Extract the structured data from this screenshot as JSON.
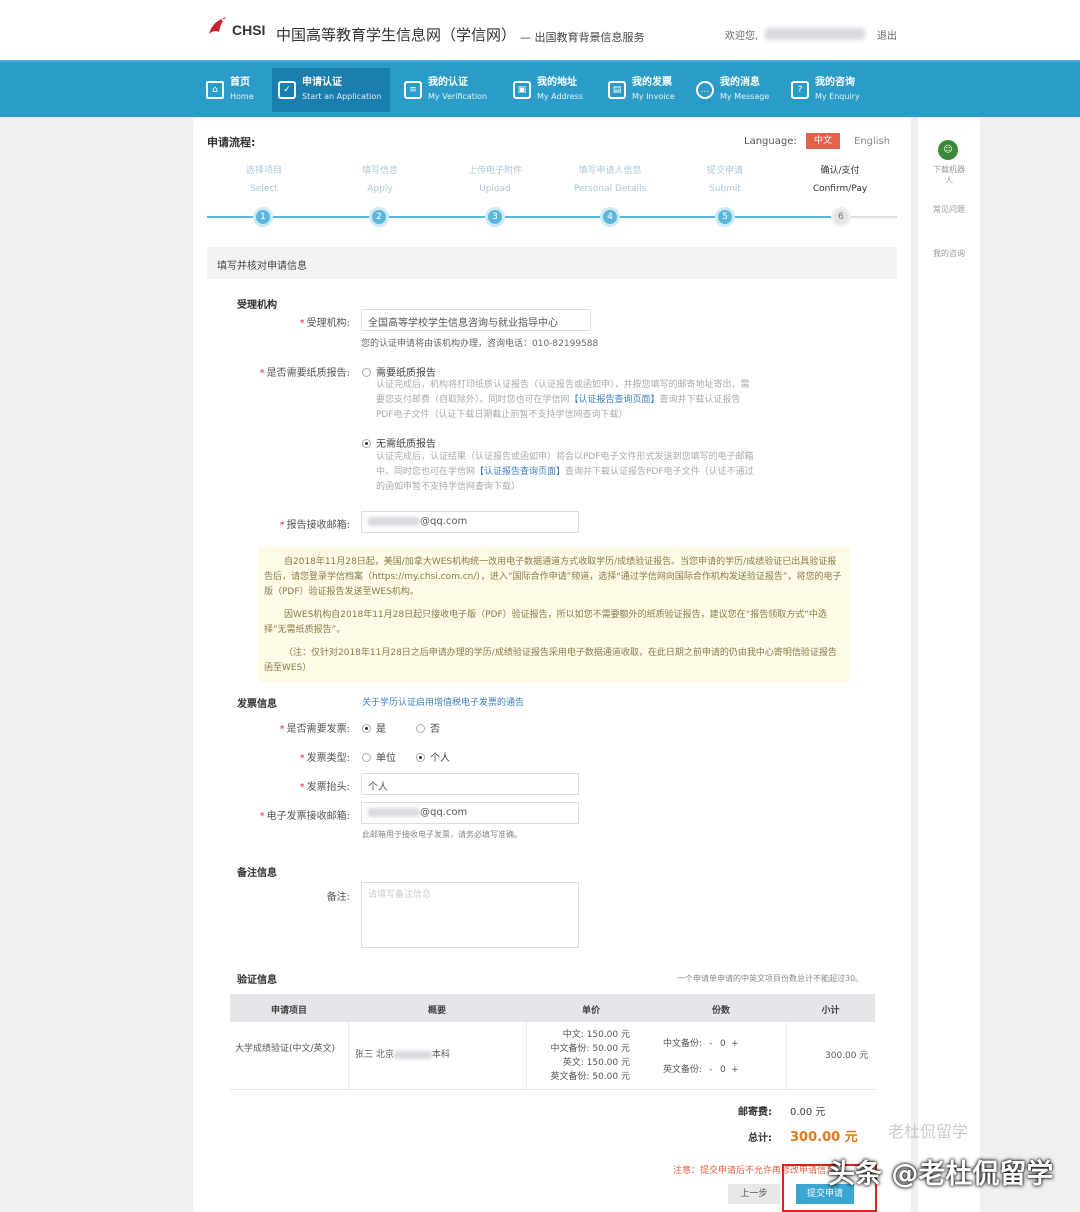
{
  "header": {
    "logo_text": "CHSI",
    "site_title": "中国高等教育学生信息网（学信网）",
    "site_subtitle": "— 出国教育背景信息服务",
    "welcome": "欢迎您,",
    "logout": "退出"
  },
  "nav": [
    {
      "cn": "首页",
      "en": "Home",
      "icon": "home-icon"
    },
    {
      "cn": "申请认证",
      "en": "Start an Application",
      "icon": "check-icon"
    },
    {
      "cn": "我的认证",
      "en": "My Verification",
      "icon": "certificate-icon"
    },
    {
      "cn": "我的地址",
      "en": "My Address",
      "icon": "address-icon"
    },
    {
      "cn": "我的发票",
      "en": "My Invoice",
      "icon": "invoice-icon"
    },
    {
      "cn": "我的消息",
      "en": "My Message",
      "icon": "message-icon"
    },
    {
      "cn": "我的咨询",
      "en": "My Enquiry",
      "icon": "enquiry-icon"
    }
  ],
  "process": {
    "title": "申请流程:",
    "language_label": "Language:",
    "lang_cn": "中文",
    "lang_en": "English",
    "steps": [
      {
        "cn": "选择项目",
        "en": "Select",
        "num": "1"
      },
      {
        "cn": "填写信息",
        "en": "Apply",
        "num": "2"
      },
      {
        "cn": "上传电子附件",
        "en": "Upload",
        "num": "3"
      },
      {
        "cn": "填写申请人信息",
        "en": "Personal Details",
        "num": "4"
      },
      {
        "cn": "提交申请",
        "en": "Submit",
        "num": "5"
      },
      {
        "cn": "确认/支付",
        "en": "Confirm/Pay",
        "num": "6"
      }
    ],
    "current_step": 6
  },
  "form": {
    "section_title": "填写并核对申请信息",
    "institution": {
      "heading": "受理机构",
      "label": "受理机构:",
      "value": "全国高等学校学生信息咨询与就业指导中心",
      "hint": "您的认证申请将由该机构办理，咨询电话：010-82199588"
    },
    "paper_report": {
      "label": "是否需要纸质报告:",
      "option_yes": "需要纸质报告",
      "option_yes_desc_1": "认证完成后，机构将打印纸质认证报告（认证报告或函如申），并按您填写的邮寄地址寄出，需",
      "option_yes_desc_2": "要您支付邮费（自取除外）。同时您也可在学信网",
      "option_yes_link": "【认证报告查询页面】",
      "option_yes_desc_3": "查询并下载认证报告",
      "option_yes_desc_4": "PDF电子文件（认证下载日期截止前暂不支持学信网查询下载）",
      "option_no": "无需纸质报告",
      "option_no_desc_1": "认证完成后，认证结果（认证报告或函如申）将会以PDF电子文件形式发送到您填写的电子邮箱",
      "option_no_desc_2": "中。同时您也可在学信网",
      "option_no_link": "【认证报告查询页面】",
      "option_no_desc_3": "查询并下载认证报告PDF电子文件（认证不通过",
      "option_no_desc_4": "的函如申暂不支持学信网查询下载）",
      "selected": "no"
    },
    "report_email": {
      "label": "报告接收邮箱:",
      "suffix": "@qq.com"
    },
    "notice": {
      "p1": "自2018年11月28日起，美国/加拿大WES机构统一改用电子数据通道方式收取学历/成绩验证报告。当您申请的学历/成绩验证已出具验证报告后，请您登录学信档案（https://my.chsi.com.cn/），进入“国际合作申请”频道，选择“通过学信网向国际合作机构发送验证报告”，将您的电子版（PDF）验证报告发送至WES机构。",
      "p2": "因WES机构自2018年11月28日起只接收电子版（PDF）验证报告，所以如您不需要额外的纸质验证报告，建议您在“报告领取方式”中选择“无需纸质报告”。",
      "p3": "（注：仅针对2018年11月28日之后申请办理的学历/成绩验证报告采用电子数据通道收取，在此日期之前申请的仍由我中心寄明信验证报告函至WES）"
    },
    "invoice": {
      "heading": "发票信息",
      "link": "关于学历认证启用增值税电子发票的通告",
      "need_label": "是否需要发票:",
      "need_yes": "是",
      "need_no": "否",
      "type_label": "发票类型:",
      "type_unit": "单位",
      "type_personal": "个人",
      "title_label": "发票抬头:",
      "title_value": "个人",
      "email_label": "电子发票接收邮箱:",
      "email_suffix": "@qq.com",
      "email_hint": "此邮箱用于接收电子发票，请务必填写准确。"
    },
    "remarks": {
      "heading": "备注信息",
      "label": "备注:",
      "placeholder": "请填写备注信息"
    },
    "verification": {
      "heading": "验证信息",
      "hint": "一个申请单申请的中英文项目份数总计不能超过30。",
      "columns": [
        "申请项目",
        "概要",
        "单价",
        "份数",
        "小计"
      ],
      "row": {
        "item": "大学成绩验证(中文/英文)",
        "summary_prefix": "张三 北京",
        "summary_suffix": "本科",
        "prices": [
          {
            "label": "中文:",
            "value": "150.00 元"
          },
          {
            "label": "中文备份:",
            "value": "50.00 元"
          },
          {
            "label": "英文:",
            "value": "150.00 元"
          },
          {
            "label": "英文备份:",
            "value": "50.00 元"
          }
        ],
        "qty_cn_label": "中文备份:",
        "qty_cn_value": "0",
        "qty_en_label": "英文备份:",
        "qty_en_value": "0",
        "minus": "-",
        "plus": "+",
        "subtotal": "300.00 元"
      }
    },
    "summary": {
      "postage_label": "邮寄费:",
      "postage_value": "0.00 元",
      "total_label": "总计:",
      "total_value": "300.00 元"
    },
    "warning": "注意：提交申请后不允许再修改申请信息",
    "prev_button": "上一步",
    "submit_button": "提交申请"
  },
  "side": {
    "robot": "下载机器人",
    "faq": "常见问题",
    "enquiry": "我的咨询"
  },
  "watermark": {
    "faint": "老杜侃留学",
    "main": "头条 @老杜侃留学"
  },
  "colors": {
    "nav_bg": "#2b9cc7",
    "accent": "#3aa6d2",
    "total": "#e07a1a",
    "highlight": "#d9251c"
  }
}
